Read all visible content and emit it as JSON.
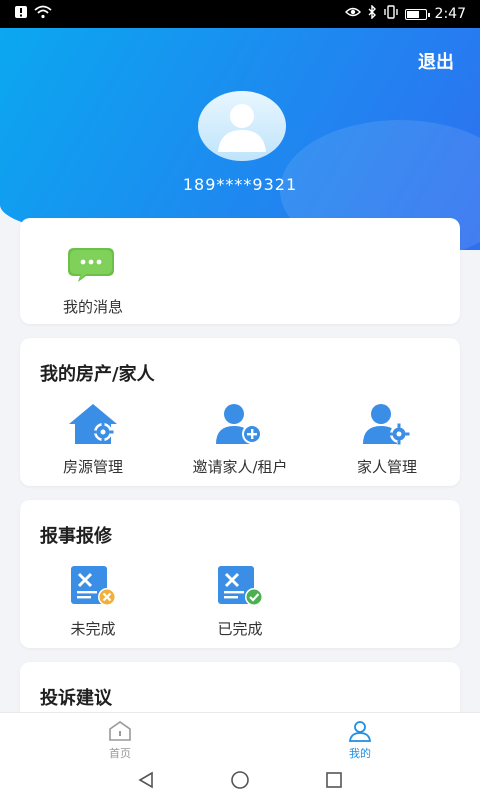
{
  "status_bar": {
    "time": "2:47"
  },
  "header": {
    "logout_label": "退出",
    "phone": "189****9321"
  },
  "messages_card": {
    "item_label": "我的消息"
  },
  "property_card": {
    "title": "我的房产/家人",
    "items": [
      {
        "label": "房源管理",
        "icon": "house-gear-icon"
      },
      {
        "label": "邀请家人/租户",
        "icon": "person-add-icon"
      },
      {
        "label": "家人管理",
        "icon": "person-gear-icon"
      }
    ]
  },
  "repair_card": {
    "title": "报事报修",
    "items": [
      {
        "label": "未完成",
        "icon": "repair-pending-icon"
      },
      {
        "label": "已完成",
        "icon": "repair-done-icon"
      }
    ]
  },
  "complaint_card": {
    "title": "投诉建议"
  },
  "bottom_nav": {
    "items": [
      {
        "label": "首页",
        "icon": "home-icon",
        "active": false
      },
      {
        "label": "我的",
        "icon": "user-icon",
        "active": true
      }
    ]
  },
  "colors": {
    "accent": "#1f8fe6",
    "header_start": "#0aa9f0",
    "header_end": "#2f6ff0"
  }
}
